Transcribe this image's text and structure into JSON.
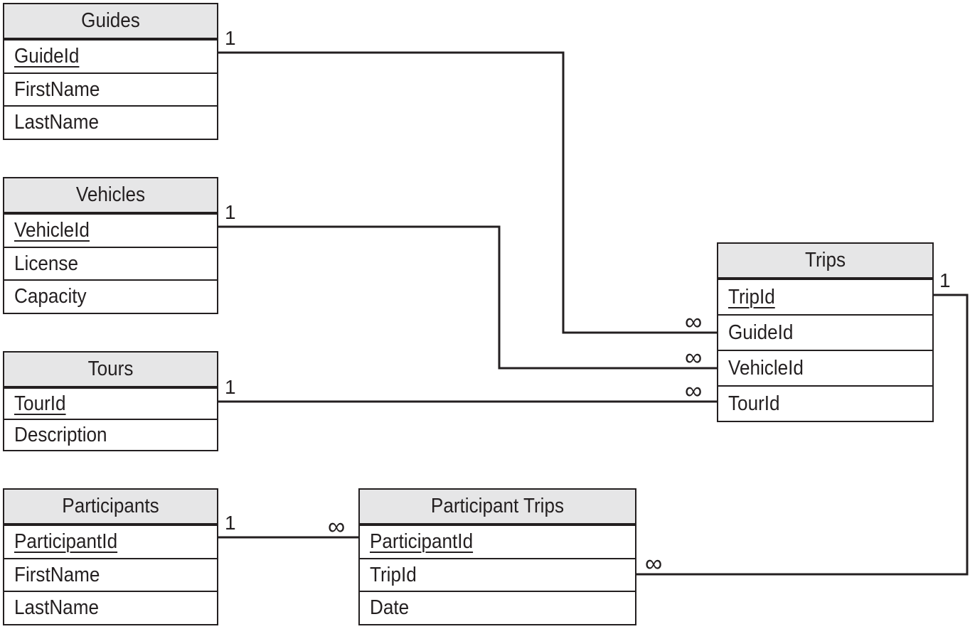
{
  "tables": [
    {
      "name": "Guides",
      "fields": [
        {
          "label": "GuideId",
          "pk": true
        },
        {
          "label": "FirstName"
        },
        {
          "label": "LastName"
        }
      ]
    },
    {
      "name": "Vehicles",
      "fields": [
        {
          "label": "VehicleId",
          "pk": true
        },
        {
          "label": "License"
        },
        {
          "label": "Capacity"
        }
      ]
    },
    {
      "name": "Tours",
      "fields": [
        {
          "label": "TourId",
          "pk": true
        },
        {
          "label": "Description"
        }
      ]
    },
    {
      "name": "Participants",
      "fields": [
        {
          "label": "ParticipantId",
          "pk": true
        },
        {
          "label": "FirstName"
        },
        {
          "label": "LastName"
        }
      ]
    },
    {
      "name": "Participant Trips",
      "fields": [
        {
          "label": "ParticipantId",
          "pk": true
        },
        {
          "label": "TripId"
        },
        {
          "label": "Date"
        }
      ]
    },
    {
      "name": "Trips",
      "fields": [
        {
          "label": "TripId",
          "pk": true
        },
        {
          "label": "GuideId"
        },
        {
          "label": "VehicleId"
        },
        {
          "label": "TourId"
        }
      ]
    }
  ],
  "relationships": [
    {
      "from": "Guides.GuideId",
      "to": "Trips.GuideId",
      "from_card": "1",
      "to_card": "∞"
    },
    {
      "from": "Vehicles.VehicleId",
      "to": "Trips.VehicleId",
      "from_card": "1",
      "to_card": "∞"
    },
    {
      "from": "Tours.TourId",
      "to": "Trips.TourId",
      "from_card": "1",
      "to_card": "∞"
    },
    {
      "from": "Participants.ParticipantId",
      "to": "Participant Trips.ParticipantId",
      "from_card": "1",
      "to_card": "∞"
    },
    {
      "from": "Trips.TripId",
      "to": "Participant Trips.TripId",
      "from_card": "1",
      "to_card": "∞"
    }
  ],
  "colors": {
    "line": "#231f20",
    "header_fill": "#e6e6e7"
  }
}
